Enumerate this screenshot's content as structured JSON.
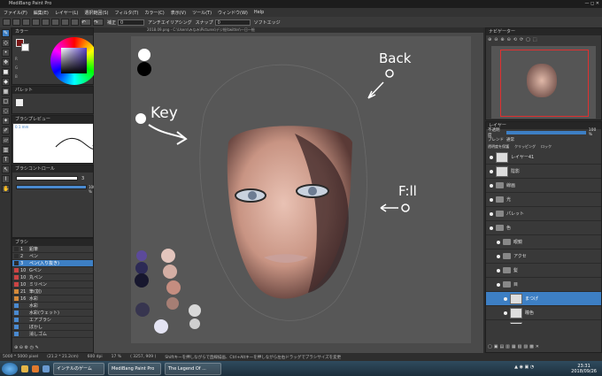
{
  "window": {
    "title": "MediBang Paint Pro"
  },
  "menu": [
    "ファイル(F)",
    "編集(E)",
    "レイヤー(L)",
    "選択範囲(S)",
    "フィルタ(T)",
    "カラー(C)",
    "表示(V)",
    "ツール(T)",
    "ウィンドウ(W)",
    "Help"
  ],
  "toolbar": {
    "correction_label": "補正",
    "correction_value": "0",
    "antialias_label": "アンチエイリアシング",
    "snap_label": "スナップ",
    "snap_value": "0",
    "softedge_label": "ソフトエッジ"
  },
  "document_tab": "2018.09.png - C:\\Users\\みなみ\\Pictures\\デジ絵\\twitter\\一日一絵",
  "panels": {
    "color": "カラー",
    "palette": "パレット",
    "brush_preview": "ブラシプレビュー",
    "brush_size_text": "0.1 mm",
    "brush_control": "ブラシコントロール",
    "brush_size_value": "3",
    "brush_opacity_value": "100 %",
    "brush": "ブラシ",
    "navigator": "ナビゲーター",
    "layer": "レイヤー"
  },
  "brushes": [
    {
      "num": "1",
      "name": "鉛筆",
      "color": "#2d2d2d"
    },
    {
      "num": "2",
      "name": "ペン",
      "color": "#2d2d2d"
    },
    {
      "num": "3",
      "name": "ペン(入り抜き)",
      "color": "#2d2d2d",
      "selected": true
    },
    {
      "num": "10",
      "name": "Gペン",
      "color": "#cc4444"
    },
    {
      "num": "10",
      "name": "丸ペン",
      "color": "#cc4444"
    },
    {
      "num": "10",
      "name": "ミリペン",
      "color": "#cc4444"
    },
    {
      "num": "21",
      "name": "筆(割)",
      "color": "#d58a3a"
    },
    {
      "num": "16",
      "name": "水彩",
      "color": "#d58a3a"
    },
    {
      "num": "",
      "name": "水彩",
      "color": "#4a8ad0"
    },
    {
      "num": "",
      "name": "水彩(ウェット)",
      "color": "#4a8ad0"
    },
    {
      "num": "",
      "name": "エアブラシ",
      "color": "#4a8ad0"
    },
    {
      "num": "",
      "name": "ぼかし",
      "color": "#4a8ad0"
    },
    {
      "num": "",
      "name": "消しゴム",
      "color": "#4a8ad0"
    }
  ],
  "canvas_annotations": {
    "key": "Key",
    "back": "Back",
    "fill": "F:ll"
  },
  "layer_panel": {
    "opacity_label": "不透明度",
    "opacity_value": "100 %",
    "blend_label": "ブレンド",
    "blend_value": "通常",
    "protect_label": "透明度を保護",
    "clipping_label": "クリッピング",
    "lock_label": "ロック",
    "layers": [
      {
        "name": "レイヤー41",
        "type": "layer",
        "indent": 0
      },
      {
        "name": "陰影",
        "type": "layer",
        "indent": 0
      },
      {
        "name": "線画",
        "type": "folder",
        "indent": 0
      },
      {
        "name": "光",
        "type": "folder",
        "indent": 0
      },
      {
        "name": "パレット",
        "type": "folder",
        "indent": 0
      },
      {
        "name": "色",
        "type": "folder",
        "indent": 0
      },
      {
        "name": "眼鏡",
        "type": "folder",
        "indent": 1
      },
      {
        "name": "アクセ",
        "type": "folder",
        "indent": 1
      },
      {
        "name": "髪",
        "type": "folder",
        "indent": 1
      },
      {
        "name": "目",
        "type": "folder",
        "indent": 1
      },
      {
        "name": "まつげ",
        "type": "layer",
        "indent": 2,
        "selected": true
      },
      {
        "name": "瞳色",
        "type": "layer",
        "indent": 2
      },
      {
        "name": "黒色",
        "type": "layer",
        "indent": 2
      }
    ]
  },
  "status": {
    "size": "5000 * 5000 pixel",
    "mm": "(21.2 * 21.2cm)",
    "dpi": "600 dpi",
    "zoom": "17 %",
    "coords": "( 3257, 909 )",
    "hint": "Shiftキーを押しながらで直線描画、Ctrl+Altキーを押しながら左右ドラッグでブラシサイズを変更"
  },
  "taskbar": {
    "items": [
      "インテルのゲーム",
      "MediBang Paint Pro",
      "The Legend Of ..."
    ],
    "time": "23:31",
    "date": "2018/09/26"
  },
  "colors": {
    "accent": "#3d7fc4",
    "canvas_bg": "#575757"
  }
}
